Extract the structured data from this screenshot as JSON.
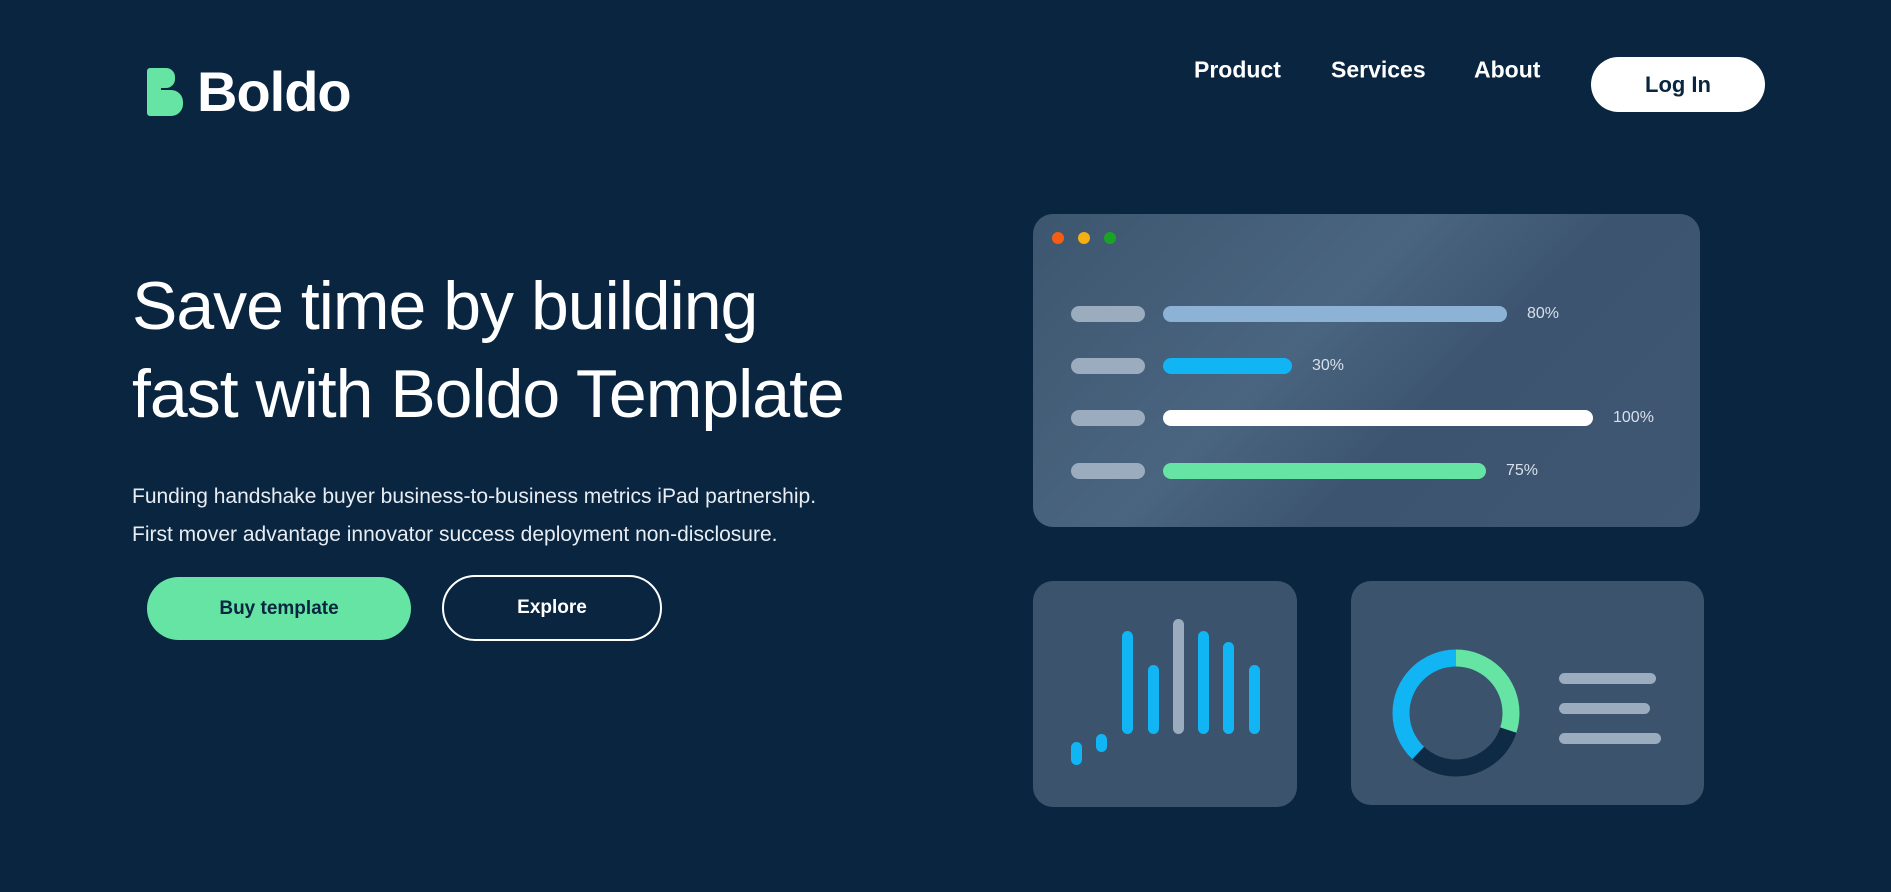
{
  "header": {
    "logo_text": "Boldo",
    "nav": [
      "Product",
      "Services",
      "About"
    ],
    "login_label": "Log In"
  },
  "hero": {
    "title_lines": [
      "Save time by building",
      "fast with Boldo Template"
    ],
    "description_lines": [
      "Funding handshake buyer business-to-business metrics iPad partnership.",
      "First mover advantage innovator success deployment non-disclosure."
    ],
    "buy_label": "Buy template",
    "explore_label": "Explore"
  },
  "colors": {
    "background": "#0a2540",
    "accent_green": "#65e4a3",
    "accent_blue": "#11b5f4",
    "muted_blue": "#8cb2d6",
    "window_red": "#f55d13",
    "window_yellow": "#f3b012",
    "window_green": "#1aa425"
  },
  "dashboard": {
    "progress": [
      {
        "percent": 80,
        "label": "80%",
        "color": "#8cb2d6"
      },
      {
        "percent": 30,
        "label": "30%",
        "color": "#11b5f4"
      },
      {
        "percent": 100,
        "label": "100%",
        "color": "#ffffff"
      },
      {
        "percent": 75,
        "label": "75%",
        "color": "#65e4a3"
      }
    ],
    "bar_chart": {
      "values": [
        10,
        8,
        45,
        30,
        50,
        45,
        40,
        30
      ],
      "highlight_index": 4
    },
    "donut": {
      "segments": [
        {
          "fraction": 0.3,
          "color": "#65e4a3"
        },
        {
          "fraction": 0.32,
          "color": "#0f2a44"
        },
        {
          "fraction": 0.38,
          "color": "#11b5f4"
        }
      ]
    }
  }
}
